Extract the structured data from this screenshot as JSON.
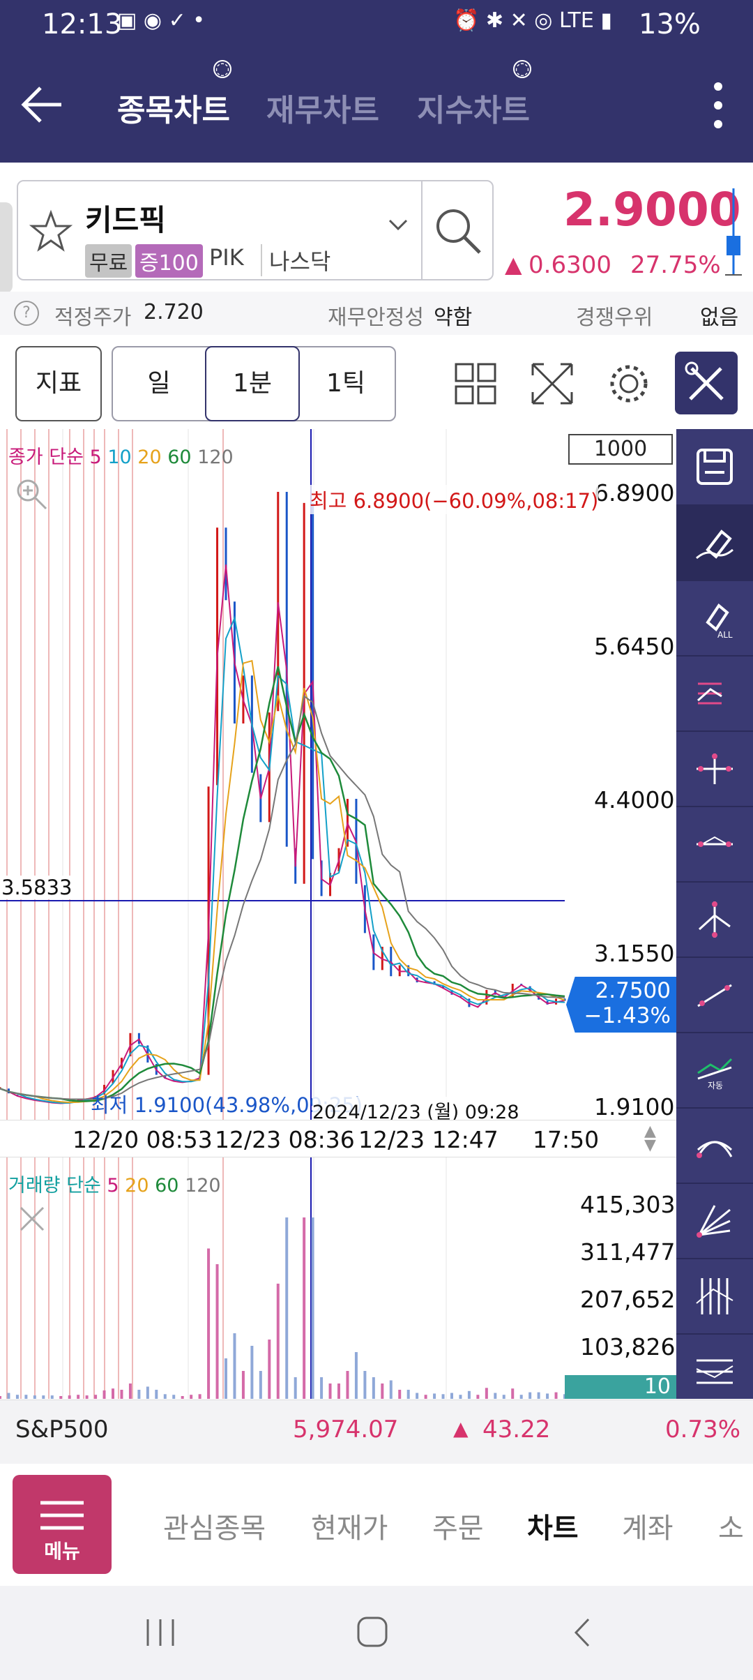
{
  "status": {
    "time": "12:13",
    "battery": "13%"
  },
  "header": {
    "tabs": [
      "종목차트",
      "재무차트",
      "지수차트"
    ],
    "active_tab": "종목차트"
  },
  "stock": {
    "name": "키드픽",
    "badge_free": "무료",
    "badge_margin": "증100",
    "ticker": "PIK",
    "market": "나스닥",
    "price": "2.9000",
    "change": "0.6300",
    "change_pct": "27.75%"
  },
  "fair": {
    "help": "?",
    "label": "적정주가",
    "value": "2.720",
    "fin_label": "재무안정성",
    "fin_value": "약함",
    "comp_label": "경쟁우위",
    "comp_value": "없음"
  },
  "toolbar": {
    "indicator": "지표",
    "day": "일",
    "min1": "1분",
    "tick1": "1틱"
  },
  "chart_data": {
    "type": "line",
    "legend_price": {
      "prefix": "종가 단순",
      "periods": [
        "5",
        "10",
        "20",
        "60",
        "120"
      ]
    },
    "legend_volume": {
      "prefix": "거래량 단순",
      "periods": [
        "5",
        "20",
        "60",
        "120"
      ]
    },
    "count_box": "1000",
    "y_ticks": [
      "6.8900",
      "5.6450",
      "4.4000",
      "3.1550",
      "1.9100"
    ],
    "ylim": [
      1.91,
      6.89
    ],
    "high_label": "최고 6.8900(−60.09%,08:17)",
    "low_label": "최저 1.9100(43.98%,09:25)",
    "crosshair_price": "3.5833",
    "crosshair_time": "2024/12/23 (월) 09:28",
    "current": {
      "price": "2.7500",
      "change": "−1.43%"
    },
    "x_ticks": [
      "12/20 08:53",
      "12/23 08:36",
      "12/23 12:47",
      "17:50"
    ],
    "volume_ticks": [
      "415,303",
      "311,477",
      "207,652",
      "103,826"
    ],
    "volume_current": "10",
    "price_series": [
      2.05,
      2.0,
      1.98,
      1.96,
      1.95,
      1.94,
      1.93,
      1.93,
      1.94,
      1.96,
      1.97,
      1.99,
      2.08,
      2.2,
      2.3,
      2.5,
      2.4,
      2.25,
      2.15,
      2.12,
      2.1,
      2.1,
      2.12,
      2.15,
      4.5,
      6.6,
      6.0,
      5.0,
      5.4,
      4.6,
      4.2,
      5.1,
      6.89,
      4.0,
      3.7,
      6.8,
      3.9,
      3.6,
      3.8,
      4.0,
      4.4,
      3.7,
      3.3,
      3.0,
      3.2,
      2.95,
      3.05,
      2.95,
      2.9,
      2.92,
      2.88,
      2.85,
      2.8,
      2.78,
      2.7,
      2.72,
      2.85,
      2.8,
      2.78,
      2.9,
      2.88,
      2.82,
      2.76,
      2.72,
      2.78,
      2.75
    ]
  },
  "index_bar": {
    "name": "S&P500",
    "value": "5,974.07",
    "change": "43.22",
    "pct": "0.73%"
  },
  "menu": {
    "label": "메뉴"
  },
  "bottom_nav": [
    "관심종목",
    "현재가",
    "주문",
    "차트",
    "계좌",
    "소"
  ],
  "colors": {
    "header": "#33336b",
    "accent": "#d7336c",
    "toolbar": "#3a3a73",
    "current_price": "#1a6fe0"
  }
}
